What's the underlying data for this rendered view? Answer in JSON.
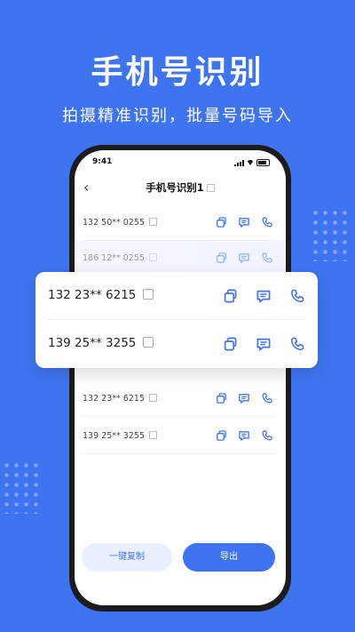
{
  "promo": {
    "headline": "手机号识别",
    "subline": "拍摄精准识别，批量号码导入"
  },
  "status_bar": {
    "time": "9:41"
  },
  "nav": {
    "back_icon": "chevron-left-icon",
    "title": "手机号识别1"
  },
  "list_top": [
    {
      "number": "132 50** 0255"
    },
    {
      "number": "186 12** 0255"
    }
  ],
  "highlight_card": [
    {
      "number": "132 23** 6215"
    },
    {
      "number": "139 25** 3255"
    }
  ],
  "list_bottom": [
    {
      "number": "132 23** 6215"
    },
    {
      "number": "139 25** 3255"
    }
  ],
  "actions": {
    "copy_all": "一键复制",
    "export": "导出"
  },
  "colors": {
    "brand": "#3f74f0",
    "brand_light": "#eaf0ff"
  }
}
